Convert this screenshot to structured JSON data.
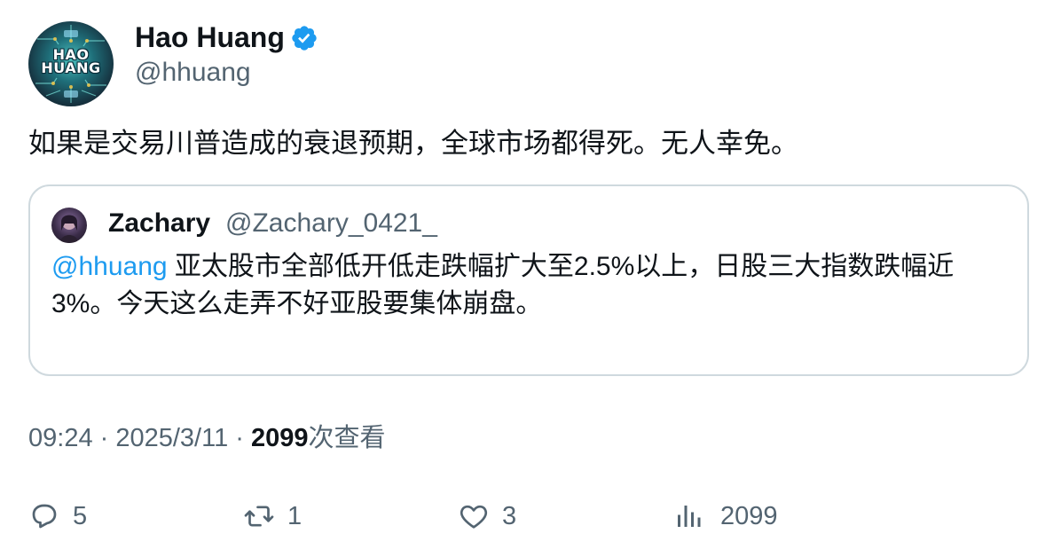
{
  "author": {
    "display_name": "Hao Huang",
    "handle": "@hhuang",
    "avatar_line1": "HAO",
    "avatar_line2": "HUANG",
    "verified_color": "#1d9bf0"
  },
  "tweet": {
    "text": "如果是交易川普造成的衰退预期，全球市场都得死。无人幸免。"
  },
  "quote": {
    "display_name": "Zachary",
    "handle": "@Zachary_0421_",
    "mention": "@hhuang",
    "text": " 亚太股市全部低开低走跌幅扩大至2.5%以上，日股三大指数跌幅近3%。今天这么走弄不好亚股要集体崩盘。"
  },
  "meta": {
    "time": "09:24",
    "separator1": " · ",
    "date": "2025/3/11",
    "separator2": " · ",
    "views_count": "2099",
    "views_label": "次查看"
  },
  "actions": {
    "reply_count": "5",
    "retweet_count": "1",
    "like_count": "3",
    "views_count": "2099"
  },
  "colors": {
    "text": "#0f1419",
    "secondary": "#536471",
    "accent": "#1d9bf0",
    "border": "#cfd9de"
  }
}
